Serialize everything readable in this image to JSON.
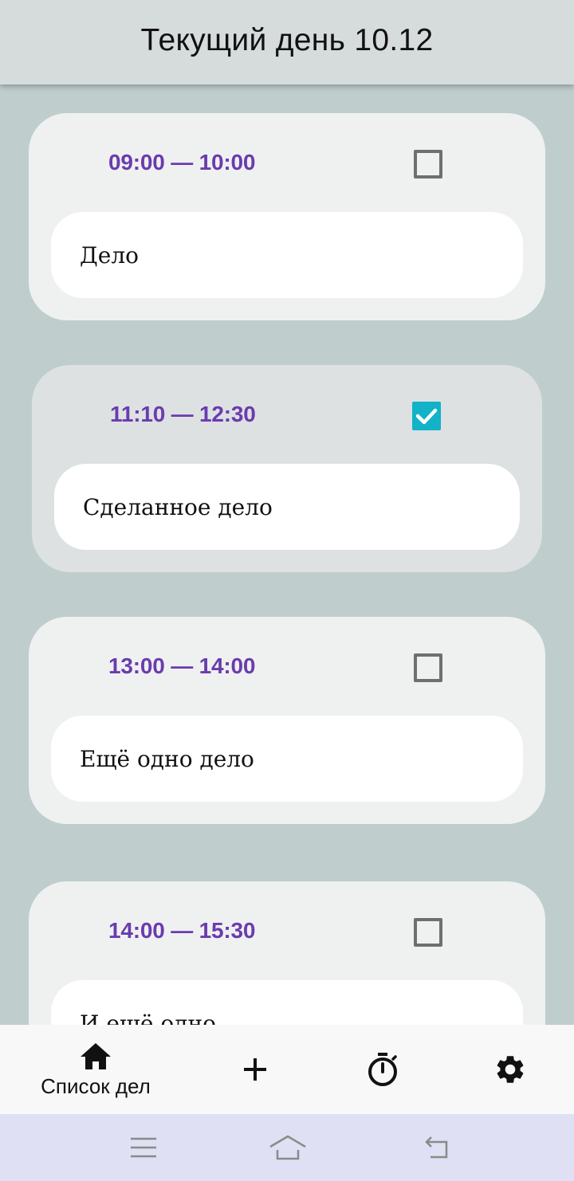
{
  "header": {
    "title": "Текущий день 10.12"
  },
  "tasks": [
    {
      "time": "09:00 — 10:00",
      "text": "Дело",
      "done": false
    },
    {
      "time": "11:10 — 12:30",
      "text": "Сделанное дело",
      "done": true
    },
    {
      "time": "13:00 — 14:00",
      "text": "Ещё одно дело",
      "done": false
    },
    {
      "time": "14:00 — 15:30",
      "text": "И ещё одно",
      "done": false
    }
  ],
  "bottom_nav": {
    "items": [
      {
        "icon": "home-icon",
        "label": "Список дел",
        "active": true
      },
      {
        "icon": "plus-icon",
        "label": ""
      },
      {
        "icon": "timer-icon",
        "label": ""
      },
      {
        "icon": "gear-icon",
        "label": ""
      }
    ]
  },
  "system_nav": {
    "buttons": [
      "menu-icon",
      "home-outline-icon",
      "back-icon"
    ]
  },
  "colors": {
    "time_text": "#6a3cae",
    "checkbox_checked": "#12b2c8",
    "background": "#bfcdcd"
  }
}
